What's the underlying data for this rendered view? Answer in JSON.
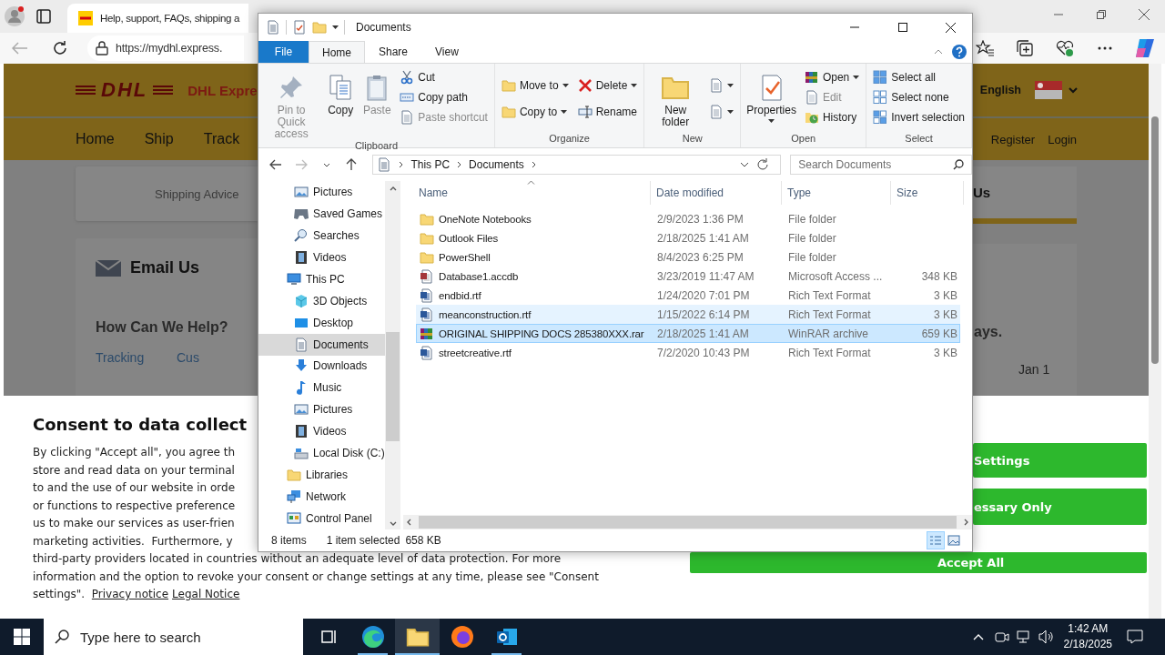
{
  "browser": {
    "tab": {
      "title": "Help, support, FAQs, shipping a"
    },
    "url": "https://mydhl.express."
  },
  "dhl_page": {
    "logo": "DHL",
    "brand": "DHL Expre",
    "language": "English",
    "nav": [
      "Home",
      "Ship",
      "Track"
    ],
    "account_links": [
      "Register",
      "Login"
    ],
    "shipping_advice": "Shipping Advice",
    "email_heading": "Email Us",
    "help_heading": "How Can We Help?",
    "help_links": [
      "Tracking",
      "Cus"
    ],
    "right_tab": "Us",
    "right_heading": "ays.",
    "right_date": "Jan 1"
  },
  "consent": {
    "title": "Consent to data collect",
    "text": "By clicking \"Accept all\", you agree th\nstore and read data on your terminal\nto and the use of our website in orde\nor functions to respective preference\nus to make our services as user-frien\nmarketing activities.  Furthermore, y\nthird-party providers located in countries without an adequate level of data protection. For more\ninformation and the option to revoke your consent or change settings at any time, please see \"Consent\nsettings\".  ",
    "links": [
      "Privacy notice",
      "Legal Notice"
    ],
    "buttons": [
      "Settings",
      "essary Only",
      "Accept All"
    ]
  },
  "explorer": {
    "title": "Documents",
    "ribbon_tabs": [
      {
        "label": "File",
        "kind": "file",
        "selected": false
      },
      {
        "label": "Home",
        "kind": "tab",
        "selected": true
      },
      {
        "label": "Share",
        "kind": "tab",
        "selected": false
      },
      {
        "label": "View",
        "kind": "tab",
        "selected": false
      }
    ],
    "ribbon_groups": [
      {
        "label": "Clipboard",
        "columns": [
          [
            {
              "label": "Pin to Quick access",
              "kind": "large",
              "disabled": true,
              "dropdown": false
            }
          ],
          [
            {
              "label": "Copy",
              "kind": "large",
              "disabled": false,
              "dropdown": false
            }
          ],
          [
            {
              "label": "Paste",
              "kind": "large",
              "disabled": true,
              "dropdown": false
            }
          ],
          [
            {
              "label": "Cut",
              "kind": "small",
              "disabled": false,
              "dropdown": false
            },
            {
              "label": "Copy path",
              "kind": "small",
              "disabled": false,
              "dropdown": false
            },
            {
              "label": "Paste shortcut",
              "kind": "small",
              "disabled": true,
              "dropdown": false
            }
          ]
        ]
      },
      {
        "label": "Organize",
        "columns": [
          [
            {
              "label": "Move to",
              "kind": "small",
              "disabled": false,
              "dropdown": true
            },
            {
              "label": "Copy to",
              "kind": "small",
              "disabled": false,
              "dropdown": true
            }
          ],
          [
            {
              "label": "Delete",
              "kind": "small",
              "disabled": false,
              "dropdown": true
            },
            {
              "label": "Rename",
              "kind": "small",
              "disabled": false,
              "dropdown": false
            }
          ]
        ]
      },
      {
        "label": "New",
        "columns": [
          [
            {
              "label": "New folder",
              "kind": "large",
              "disabled": false,
              "dropdown": false
            }
          ],
          [
            {
              "kind": "icon",
              "disabled": false,
              "dropdown": true
            },
            {
              "kind": "icon",
              "disabled": false,
              "dropdown": true
            }
          ]
        ]
      },
      {
        "label": "Open",
        "columns": [
          [
            {
              "label": "Properties",
              "kind": "large",
              "disabled": false,
              "dropdown": true
            }
          ],
          [
            {
              "label": "Open",
              "kind": "small",
              "disabled": false,
              "dropdown": true
            },
            {
              "label": "Edit",
              "kind": "small",
              "disabled": true,
              "dropdown": false
            },
            {
              "label": "History",
              "kind": "small",
              "disabled": false,
              "dropdown": false
            }
          ]
        ]
      },
      {
        "label": "Select",
        "columns": [
          [
            {
              "label": "Select all",
              "kind": "small",
              "disabled": false,
              "dropdown": false
            },
            {
              "label": "Select none",
              "kind": "small",
              "disabled": false,
              "dropdown": false
            },
            {
              "label": "Invert selection",
              "kind": "small",
              "disabled": false,
              "dropdown": false
            }
          ]
        ]
      }
    ],
    "path": [
      "This PC",
      "Documents"
    ],
    "search_placeholder": "Search Documents",
    "nav_pane": {
      "partial_children": [
        {
          "label": "Pictures",
          "selected": false
        },
        {
          "label": "Saved Games",
          "selected": false
        },
        {
          "label": "Searches",
          "selected": false
        },
        {
          "label": "Videos",
          "selected": false
        }
      ],
      "items": [
        {
          "label": "This PC",
          "selected": false,
          "children": [
            {
              "label": "3D Objects",
              "selected": false
            },
            {
              "label": "Desktop",
              "selected": false
            },
            {
              "label": "Documents",
              "selected": true
            },
            {
              "label": "Downloads",
              "selected": false
            },
            {
              "label": "Music",
              "selected": false
            },
            {
              "label": "Pictures",
              "selected": false
            },
            {
              "label": "Videos",
              "selected": false
            },
            {
              "label": "Local Disk (C:)",
              "selected": false
            }
          ]
        },
        {
          "label": "Libraries",
          "selected": false
        },
        {
          "label": "Network",
          "selected": false
        },
        {
          "label": "Control Panel",
          "selected": false
        }
      ]
    },
    "columns": [
      "Name",
      "Date modified",
      "Type",
      "Size"
    ],
    "files": [
      {
        "kind": "folder",
        "name": "OneNote Notebooks",
        "date": "2/9/2023 1:36 PM",
        "type": "File folder",
        "selected": false,
        "highlighted": false
      },
      {
        "kind": "folder",
        "name": "Outlook Files",
        "date": "2/18/2025 1:41 AM",
        "type": "File folder",
        "selected": false,
        "highlighted": false
      },
      {
        "kind": "folder",
        "name": "PowerShell",
        "date": "8/4/2023 6:25 PM",
        "type": "File folder",
        "selected": false,
        "highlighted": false
      },
      {
        "kind": "access",
        "name": "Database1.accdb",
        "date": "3/23/2019 11:47 AM",
        "type": "Microsoft Access ...",
        "size": "348 KB",
        "selected": false,
        "highlighted": false
      },
      {
        "kind": "rtf",
        "name": "endbid.rtf",
        "date": "1/24/2020 7:01 PM",
        "type": "Rich Text Format",
        "size": "3 KB",
        "selected": false,
        "highlighted": false
      },
      {
        "kind": "rtf",
        "name": "meanconstruction.rtf",
        "date": "1/15/2022 6:14 PM",
        "type": "Rich Text Format",
        "size": "3 KB",
        "selected": false,
        "highlighted": true
      },
      {
        "kind": "rar",
        "name": "ORIGINAL SHIPPING DOCS 285380XXX.rar",
        "date": "2/18/2025 1:41 AM",
        "type": "WinRAR archive",
        "size": "659 KB",
        "selected": true,
        "highlighted": false
      },
      {
        "kind": "rtf",
        "name": "streetcreative.rtf",
        "date": "7/2/2020 10:43 PM",
        "type": "Rich Text Format",
        "size": "3 KB",
        "selected": false,
        "highlighted": false
      }
    ],
    "status": {
      "count": "8 items",
      "selection": "1 item selected",
      "size": "658 KB"
    },
    "views": [
      {
        "selected": true
      },
      {
        "selected": false
      }
    ]
  },
  "taskbar": {
    "search_placeholder": "Type here to search",
    "apps": [
      {
        "selected": false,
        "running": false
      },
      {
        "selected": false,
        "running": true
      },
      {
        "selected": true,
        "running": true
      },
      {
        "selected": false,
        "running": false
      },
      {
        "selected": false,
        "running": true
      }
    ],
    "time": "1:42 AM",
    "date": "2/18/2025"
  }
}
